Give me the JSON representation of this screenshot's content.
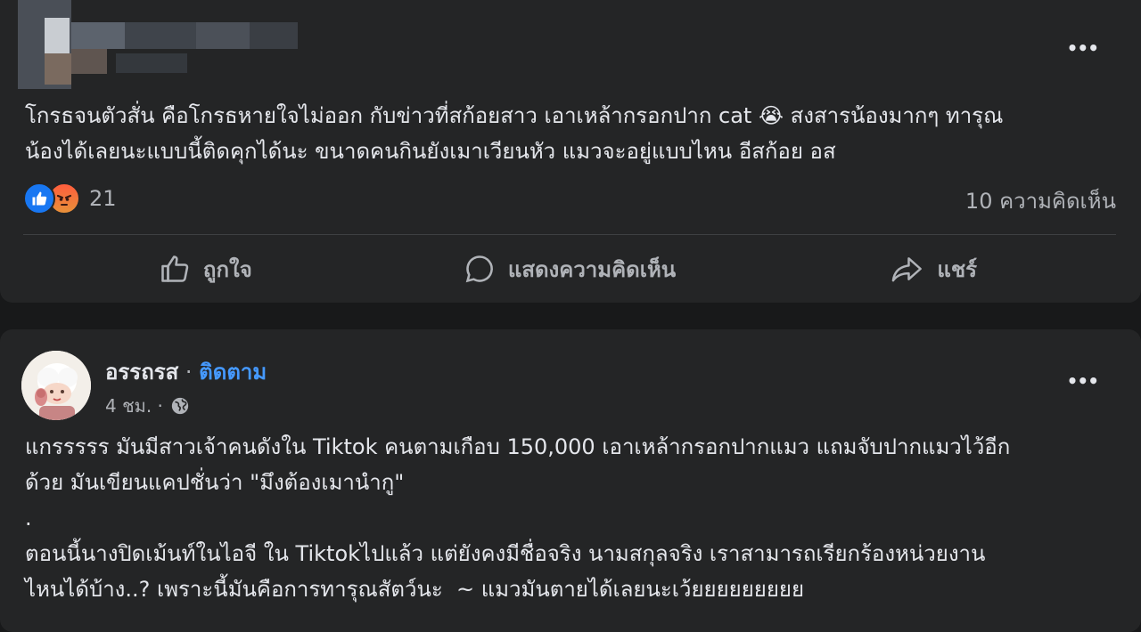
{
  "post1": {
    "text": "โกรธจนตัวสั่น คือโกรธหายใจไม่ออก กับข่าวที่สก้อยสาว เอาเหล้ากรอกปาก cat 😭 สงสารน้องมากๆ ทารุณ\nน้องได้เลยนะแบบนี้ติดคุกได้นะ ขนาดคนกินยังเมาเวียนหัว แมวจะอยู่แบบไหน อีสก้อย อส",
    "more_label": "•••",
    "reaction_count": "21",
    "comments_count": "10 ความคิดเห็น",
    "actions": {
      "like": "ถูกใจ",
      "comment": "แสดงความคิดเห็น",
      "share": "แชร์"
    }
  },
  "post2": {
    "author": "อรรถรส",
    "separator": " · ",
    "follow_label": "ติดตาม",
    "time": "4 ชม. ·",
    "more_label": "•••",
    "text": "แกรรรรร มันมีสาวเจ้าคนดังใน Tiktok คนตามเกือบ 150,000 เอาเหล้ากรอกปากแมว แถมจับปากแมวไว้อีก\nด้วย มันเขียนแคปชั่นว่า \"มึงต้องเมานำกู\"\n.\nตอนนี้นางปิดเม้นท์ในไอจี ใน Tiktokไปแล้ว แต่ยังคงมีชื่อจริง นามสกุลจริง เราสามารถเรียกร้องหน่วยงาน\nไหนได้บ้าง..? เพราะนี้มันคือการทารุณสัตว์นะ  ~ แมวมันตายได้เลยนะเว้ยยยยยยยยย"
  },
  "colors": {
    "background": "#18191a",
    "card": "#242526",
    "text_primary": "#e4e6eb",
    "text_secondary": "#b0b3b8",
    "link": "#4599ff",
    "like_blue": "#1877f2"
  },
  "icons": [
    "like-reaction-icon",
    "angry-reaction-icon",
    "thumbs-up-icon",
    "comment-bubble-icon",
    "share-arrow-icon",
    "globe-icon",
    "more-options-icon"
  ]
}
